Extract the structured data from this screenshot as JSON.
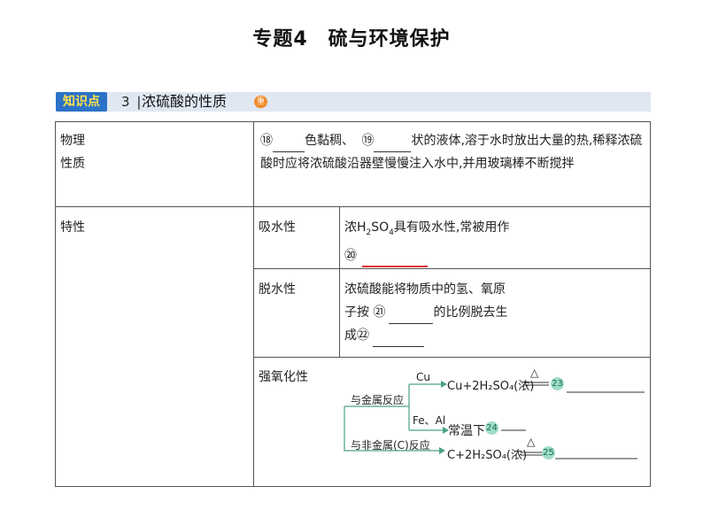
{
  "title": "专题4　硫与环境保护",
  "knowledge_point": {
    "tag": "知识点",
    "number": "3",
    "separator": "|",
    "title": "浓硫酸的性质",
    "badge": "重"
  },
  "table": {
    "physical": {
      "header_line1": "物理",
      "header_line2": "性质",
      "circle1": "⑱",
      "text1": "色黏稠、",
      "circle2": "⑲",
      "text2": "状的液体,溶于水时放出大量的热,稀释浓硫酸时应将浓硫酸沿器壁慢慢注入水中,并用玻璃棒不断搅拌"
    },
    "special_header": "特性",
    "water_absorb": {
      "label": "吸水性",
      "text_pre": "浓H",
      "sub1": "2",
      "mid": "SO",
      "sub2": "4",
      "text_post": "具有吸水性,常被用作",
      "circle": "⑳"
    },
    "dehydrate": {
      "label": "脱水性",
      "text1": "浓硫酸能将物质中的氢、氧原",
      "text2_pre": "子按",
      "circle1": "㉑",
      "text2_post": "的比例脱去生",
      "text3_pre": "成",
      "circle2": "㉒"
    },
    "oxidize": {
      "label": "强氧化性",
      "metal_label": "与金属反应",
      "nonmetal_label": "与非金属(C)反应",
      "cu_label": "Cu",
      "feal_label": "Fe、Al",
      "eq1": "Cu+2H₂SO₄(浓)",
      "eq1_condition": "△",
      "circle23": "23",
      "feal_text": "常温下",
      "circle24": "24",
      "eq2": "C+2H₂SO₄(浓)",
      "eq2_condition": "△",
      "circle25": "25"
    }
  }
}
